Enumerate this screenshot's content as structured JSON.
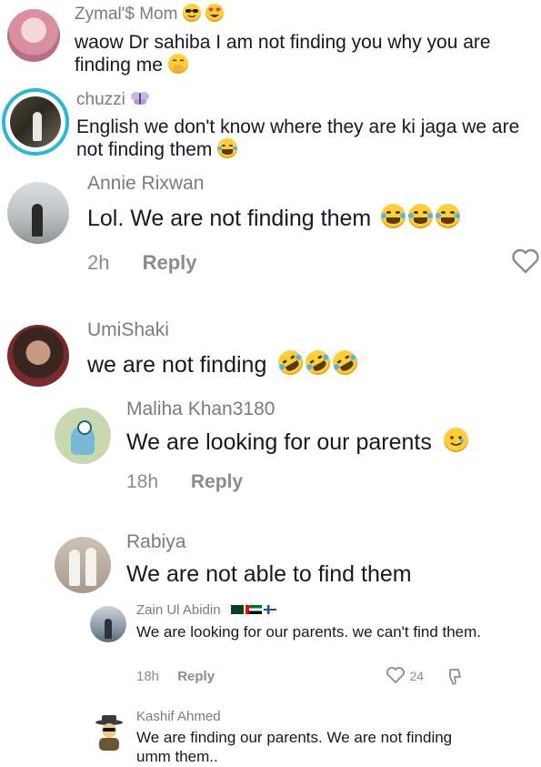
{
  "comments": [
    {
      "author": "Zymal'$ Mom",
      "text": "waow Dr sahiba I am not finding you why you are finding me",
      "author_emojis": [
        "sunglasses-emoji-icon",
        "heart-eyes-emoji-icon"
      ],
      "text_emoji": "hand-over-mouth-emoji-icon"
    },
    {
      "author": "chuzzi",
      "text": "English we don't know where they are ki jaga we are not finding them",
      "author_emojis": [
        "butterfly-icon"
      ],
      "text_emoji": "tears-of-joy-emoji-icon"
    },
    {
      "author": "Annie Rixwan",
      "text": "Lol. We are not finding them",
      "time": "2h",
      "reply_label": "Reply",
      "text_emoji": "tears-of-joy-emoji-icon"
    },
    {
      "author": "UmiShaki",
      "text": "we are not finding",
      "text_emoji": "rolling-laughing-emoji-icon"
    },
    {
      "author": "Maliha Khan3180",
      "text": "We are looking for our parents",
      "time": "18h",
      "reply_label": "Reply",
      "text_emoji": "smiling-tear-emoji-icon"
    },
    {
      "author": "Rabiya",
      "text": "We are not able to find them"
    },
    {
      "author": "Zain Ul Abidin",
      "text": "We are looking for our parents. we can't find them.",
      "time": "18h",
      "reply_label": "Reply",
      "likes": "24",
      "author_emojis": [
        "flag-pakistan-icon",
        "flag-uae-icon",
        "flag-finland-icon"
      ]
    },
    {
      "author": "Kashif Ahmed",
      "text": "We are finding our parents. We are not finding umm them.."
    }
  ],
  "colors": {
    "author": "#7a7b80",
    "text": "#161823",
    "meta": "#8a8b91",
    "ring": "#29b8d6"
  }
}
